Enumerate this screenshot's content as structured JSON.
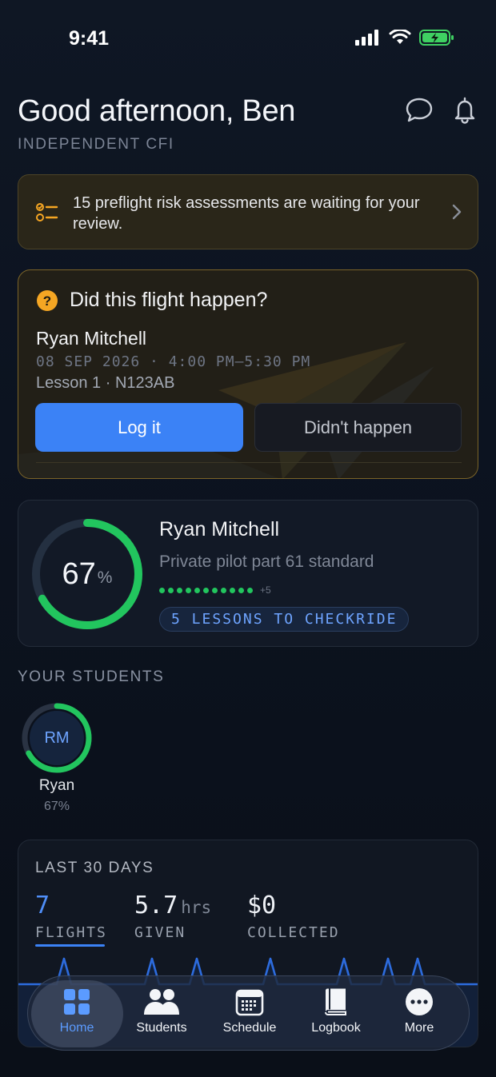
{
  "status_bar": {
    "time": "9:41"
  },
  "header": {
    "greeting": "Good afternoon, Ben",
    "role": "INDEPENDENT CFI"
  },
  "alert": {
    "text": "15 preflight risk assessments are waiting for your review."
  },
  "flight_prompt": {
    "title": "Did this flight happen?",
    "student": "Ryan Mitchell",
    "datetime": "08 SEP 2026 · 4:00 PM–5:30 PM",
    "lesson": "Lesson 1 · N123AB",
    "log_label": "Log it",
    "dismiss_label": "Didn't happen"
  },
  "progress_card": {
    "percent_value": "67",
    "percent_sign": "%",
    "progress_fraction": 0.67,
    "name": "Ryan Mitchell",
    "program": "Private pilot part 61 standard",
    "dots_more": "+5",
    "checkride_pill": "5 LESSONS TO CHECKRIDE"
  },
  "students_section": {
    "label": "YOUR STUDENTS",
    "students": [
      {
        "initials": "RM",
        "name": "Ryan",
        "percent": "67%",
        "progress_fraction": 0.67
      }
    ]
  },
  "stats": {
    "title": "LAST 30 DAYS",
    "flights": {
      "value": "7",
      "label": "FLIGHTS"
    },
    "given": {
      "value": "5.7",
      "unit": "hrs",
      "label": "GIVEN"
    },
    "collected": {
      "value": "$0",
      "label": "COLLECTED"
    }
  },
  "nav": {
    "items": [
      {
        "label": "Home",
        "icon": "grid-icon",
        "active": true
      },
      {
        "label": "Students",
        "icon": "people-icon",
        "active": false
      },
      {
        "label": "Schedule",
        "icon": "calendar-icon",
        "active": false
      },
      {
        "label": "Logbook",
        "icon": "book-icon",
        "active": false
      },
      {
        "label": "More",
        "icon": "ellipsis-icon",
        "active": false
      }
    ]
  },
  "colors": {
    "accent_blue": "#3b82f6",
    "progress_green": "#22c55e",
    "warning_amber": "#f5a623"
  }
}
